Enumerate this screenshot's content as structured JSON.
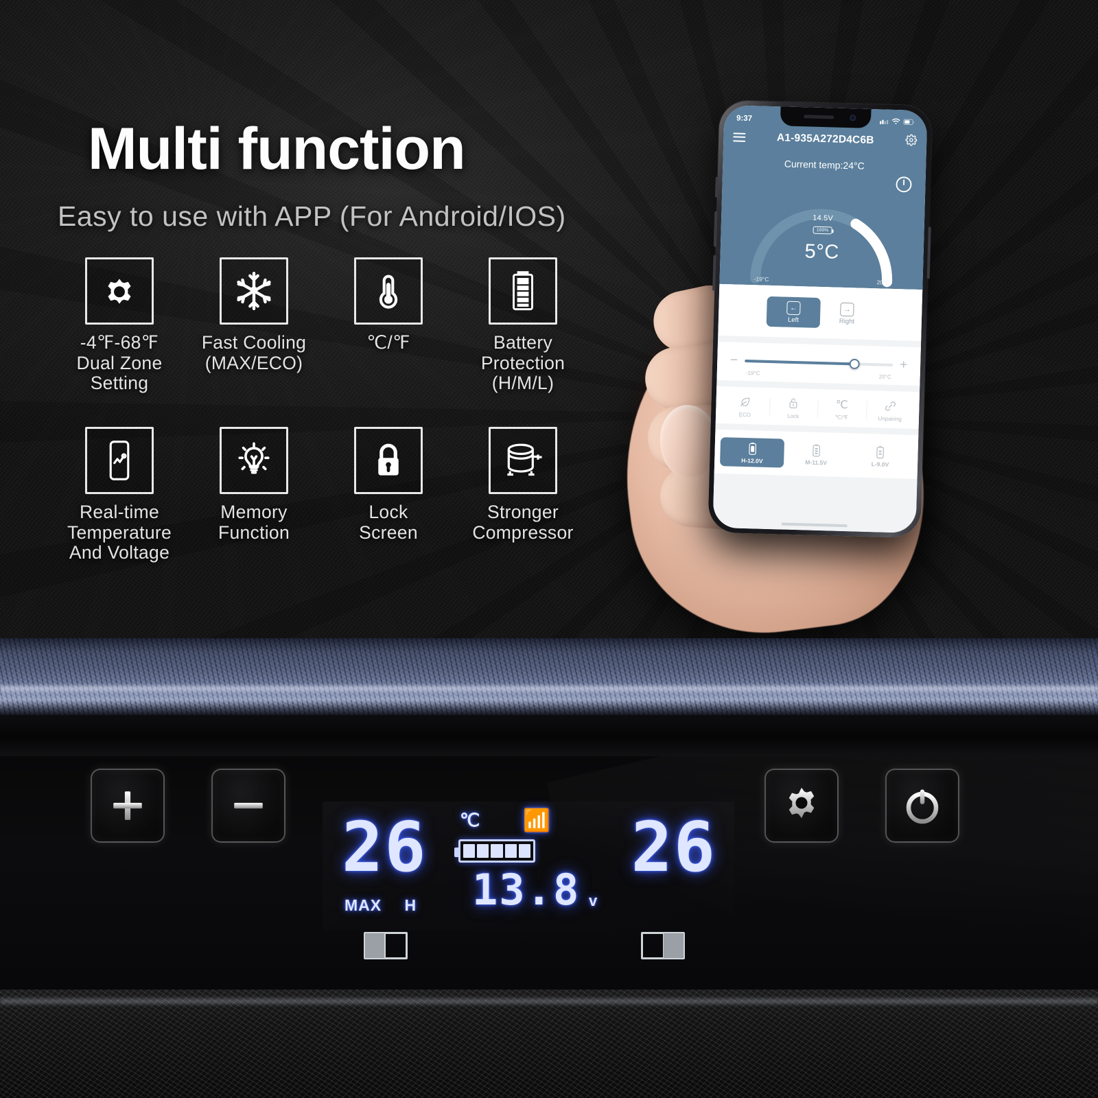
{
  "hero": {
    "headline": "Multi function",
    "subhead": "Easy to use with APP (For Android/IOS)"
  },
  "features": [
    {
      "icon": "gear-icon",
      "label": "-4℉-68℉\nDual Zone Setting"
    },
    {
      "icon": "snowflake-icon",
      "label": "Fast Cooling\n(MAX/ECO)"
    },
    {
      "icon": "thermometer-icon",
      "label": "℃/℉"
    },
    {
      "icon": "battery-icon",
      "label": "Battery Protection\n(H/M/L)"
    },
    {
      "icon": "phone-chart-icon",
      "label": "Real-time\nTemperature\nAnd  Voltage"
    },
    {
      "icon": "lightbulb-icon",
      "label": "Memory\nFunction"
    },
    {
      "icon": "lock-icon",
      "label": "Lock\nScreen"
    },
    {
      "icon": "compressor-icon",
      "label": "Stronger\nCompressor"
    }
  ],
  "phone_app": {
    "status_bar": {
      "time": "9:37"
    },
    "app_bar": {
      "menu_icon": "hamburger-icon",
      "device_name": "A1-935A272D4C6B",
      "settings_icon": "gear-icon"
    },
    "current_temp": "Current temp:24°C",
    "power_icon": "power-icon",
    "gauge": {
      "voltage": "14.5V",
      "battery_percent": "100%",
      "set_temp": "5°C",
      "min_label": "-19°C",
      "max_label": "20°C",
      "arc_track_color": "#6f93ad",
      "arc_fill_color": "#ffffff"
    },
    "zones": [
      {
        "label": "Left",
        "icon": "arrow-left-icon",
        "selected": true
      },
      {
        "label": "Right",
        "icon": "arrow-right-icon",
        "selected": false
      }
    ],
    "slider": {
      "minus_icon": "minus-icon",
      "plus_icon": "plus-icon",
      "min_label": "-19°C",
      "max_label": "20°C"
    },
    "functions": [
      {
        "label": "ECO",
        "icon": "leaf-icon"
      },
      {
        "label": "Lock",
        "icon": "lock-icon"
      },
      {
        "label": "℃/℉",
        "icon": "celsius-icon"
      },
      {
        "label": "Unpairing",
        "icon": "link-icon"
      }
    ],
    "voltage_levels": [
      {
        "label": "H-12.0V",
        "icon": "battery-full-icon",
        "selected": true
      },
      {
        "label": "M-11.5V",
        "icon": "battery-mid-icon",
        "selected": false
      },
      {
        "label": "L-9.0V",
        "icon": "battery-low-icon",
        "selected": false
      }
    ],
    "accent_color": "#5b7f9c"
  },
  "control_panel": {
    "buttons": [
      {
        "name": "plus-button",
        "icon": "plus-icon"
      },
      {
        "name": "minus-button",
        "icon": "minus-icon"
      },
      {
        "name": "gear-button",
        "icon": "gear-icon"
      },
      {
        "name": "power-button",
        "icon": "power-icon"
      }
    ],
    "lcd": {
      "left_temp": "26",
      "right_temp": "26",
      "unit": "℃",
      "bluetooth_icon": "bluetooth-icon",
      "battery_bars": 5,
      "voltage": "13.8",
      "voltage_suffix": "v",
      "mode_label": "MAX",
      "level_label": "H",
      "glow_color": "#dfe6ff"
    },
    "zone_indicators": [
      {
        "name": "zone-indicator-left",
        "filled": "left"
      },
      {
        "name": "zone-indicator-right",
        "filled": "right"
      }
    ]
  }
}
